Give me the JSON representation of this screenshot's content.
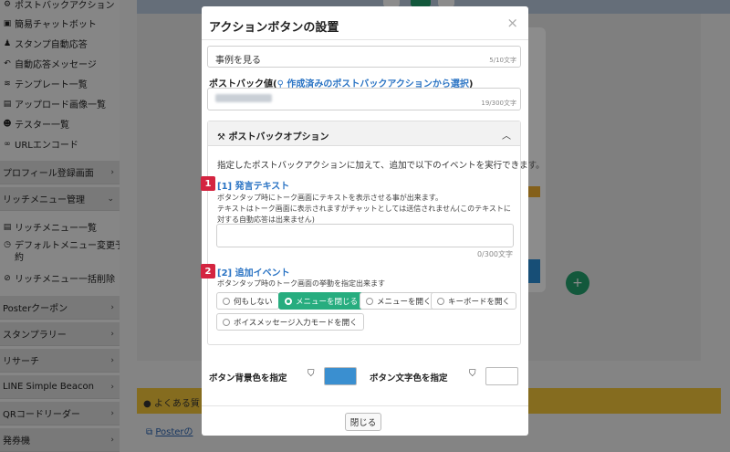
{
  "sidebar": {
    "links": [
      {
        "icon": "robot-icon",
        "label": "ポストバックアクション"
      },
      {
        "icon": "robot-icon",
        "label": "簡易チャットボット"
      },
      {
        "icon": "stamp-icon",
        "label": "スタンプ自動応答"
      },
      {
        "icon": "reply-icon",
        "label": "自動応答メッセージ"
      },
      {
        "icon": "layers-icon",
        "label": "テンプレート一覧"
      },
      {
        "icon": "image-icon",
        "label": "アップロード画像一覧"
      },
      {
        "icon": "users-icon",
        "label": "テスター一覧"
      },
      {
        "icon": "link-icon",
        "label": "URLエンコード"
      }
    ],
    "section_profile": "プロフィール登録画面",
    "section_richmenu": "リッチメニュー管理",
    "richmenu_items": [
      {
        "icon": "list-icon",
        "label": "リッチメニュー一覧"
      },
      {
        "icon": "clock-icon",
        "label_line1": "デフォルトメニュー変更予",
        "label_line2": "約"
      },
      {
        "icon": "ban-icon",
        "label": "リッチメニュー一括削除"
      }
    ],
    "sections": [
      "Posterクーポン",
      "スタンプラリー",
      "リサーチ",
      "LINE Simple Beacon",
      "QRコードリーダー",
      "発券機"
    ]
  },
  "background": {
    "yellow_bar_text": "よくある質",
    "link_text": "Posterの"
  },
  "modal": {
    "title": "アクションボタンの設置",
    "close_symbol": "×",
    "label_field_value": "事例を見る",
    "label_field_count": "5/10文字",
    "postback_label": "ポストバック値",
    "postback_link": "作成済みのポストバックアクションから選択",
    "postback_count": "19/300文字",
    "option": {
      "title": "ポストバックオプション",
      "description": "指定したポストバックアクションに加えて、追加で以下のイベントを実行できます。",
      "section1": {
        "badge": "1",
        "heading": "[1] 発言テキスト",
        "help_line1": "ボタンタップ時にトーク画面にテキストを表示させる事が出来ます。",
        "help_line2": "テキストはトーク画面に表示されますがチャットとしては送信されません(このテキストに対する自動応答は出来ません)",
        "textarea_value": "",
        "count": "0/300文字"
      },
      "section2": {
        "badge": "2",
        "heading": "[2] 追加イベント",
        "help": "ボタンタップ時のトーク画面の挙動を指定出来ます",
        "options": [
          "何もしない",
          "メニューを閉じる",
          "メニューを開く",
          "キーボードを開く",
          "ボイスメッセージ入力モードを開く"
        ],
        "selected": "メニューを閉じる"
      }
    },
    "bg_color_label": "ボタン背景色を指定",
    "bg_color": "#3a8fd0",
    "text_color_label": "ボタン文字色を指定",
    "text_color": "#ffffff",
    "close_button": "閉じる"
  },
  "colors": {
    "accent_green": "#27ad7f",
    "link_blue": "#2b74c4",
    "badge_red": "#d42440"
  }
}
